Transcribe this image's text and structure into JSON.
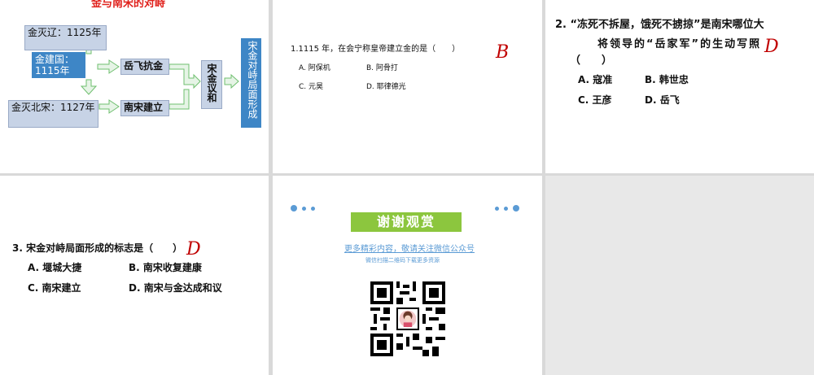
{
  "slide1": {
    "title": "金与南宋的对峙",
    "box_liao": "金灭辽：1125年",
    "box_jin": "金建国：1115年",
    "box_song": "金灭北宋：1127年",
    "box_yuefei": "岳飞抗金",
    "box_nansong": "南宋建立",
    "box_yihe": "宋金议和",
    "box_result": "宋金对峙局面形成"
  },
  "slide2": {
    "question": "1.1115 年，在会宁称皇帝建立金的是（　　）",
    "answer": "B",
    "options": [
      "A. 阿保机",
      "B. 阿骨打",
      "C. 元昊",
      "D. 耶律德光"
    ]
  },
  "slide3": {
    "question_line1": "2. “冻死不拆屋，饿死不掳掠”是南宋哪位大",
    "question_line2": "将领导的“岳家军”的生动写照",
    "question_line3": "（　　）",
    "answer": "D",
    "options": [
      "A. 寇准",
      "B. 韩世忠",
      "C. 王彦",
      "D. 岳飞"
    ]
  },
  "slide4": {
    "question": "3. 宋金对峙局面形成的标志是（　　）",
    "answer": "D",
    "options": [
      "A. 堰城大捷",
      "B. 南宋收复建康",
      "C. 南宋建立",
      "D. 南宋与金达成和议"
    ]
  },
  "slide5": {
    "banner": "谢谢观赏",
    "subtitle": "更多精彩内容，敬请关注微信公众号",
    "caption": "微信扫描二维码下载更多资源"
  },
  "colors": {
    "accent_blue": "#3e86c6",
    "box_fill": "#c7d3e6",
    "arrow_green": "#7ec87e",
    "answer_red": "#c00000",
    "banner_green": "#8cc63e"
  }
}
